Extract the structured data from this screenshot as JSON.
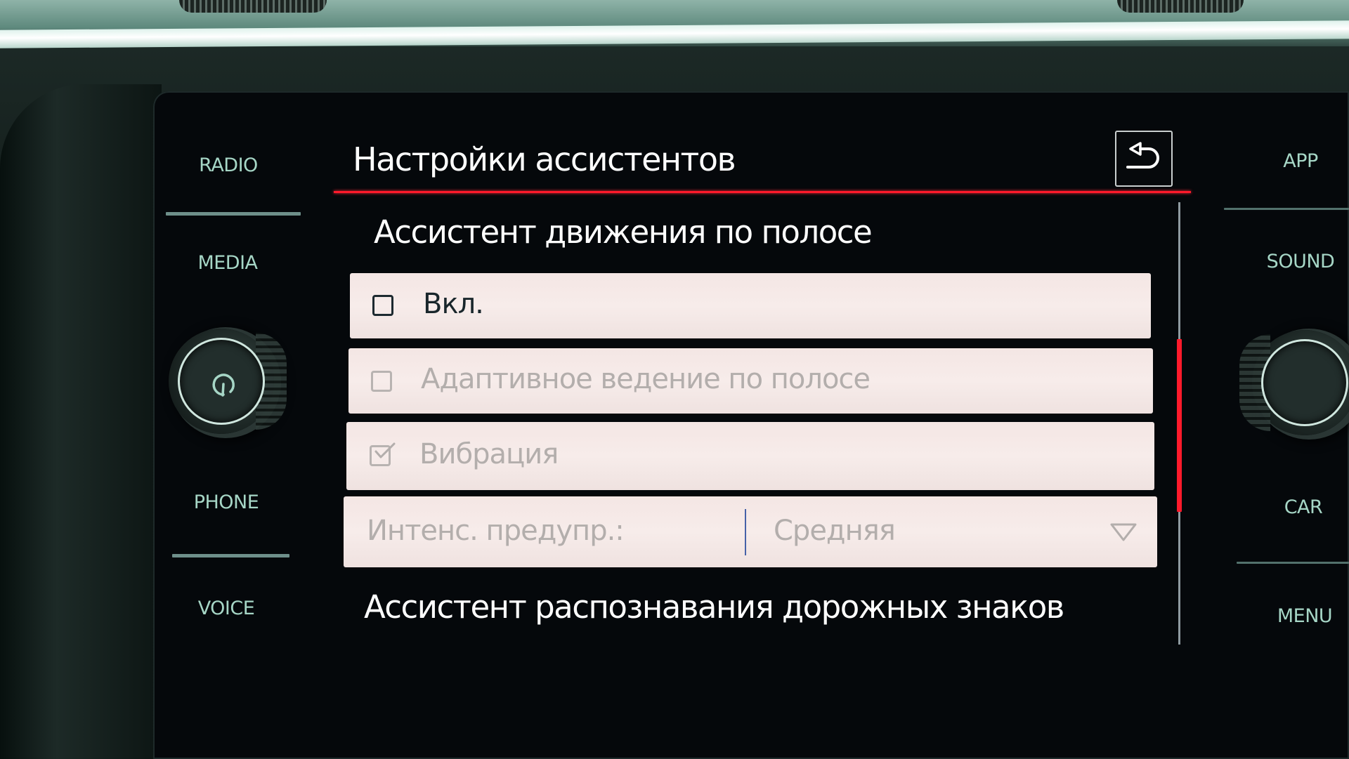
{
  "screen": {
    "title": "Настройки ассистентов",
    "back_icon": "back-arrow-icon"
  },
  "nav_left": {
    "items": [
      {
        "id": "radio",
        "label": "RADIO"
      },
      {
        "id": "media",
        "label": "MEDIA"
      },
      {
        "id": "phone",
        "label": "PHONE"
      },
      {
        "id": "voice",
        "label": "VOICE"
      }
    ],
    "knob_icon": "power-icon"
  },
  "nav_right": {
    "items": [
      {
        "id": "app",
        "label": "APP"
      },
      {
        "id": "sound",
        "label": "SOUND"
      },
      {
        "id": "car",
        "label": "CAR"
      },
      {
        "id": "menu",
        "label": "MENU"
      }
    ]
  },
  "sections": [
    {
      "header": "Ассистент движения по полосе",
      "rows": [
        {
          "type": "checkbox",
          "label": "Вкл.",
          "checked": false,
          "enabled": true
        },
        {
          "type": "checkbox",
          "label": "Адаптивное ведение по полосе",
          "checked": false,
          "enabled": false
        },
        {
          "type": "checkbox",
          "label": "Вибрация",
          "checked": true,
          "enabled": false
        },
        {
          "type": "select",
          "label": "Интенс. предупр.:",
          "value": "Средняя",
          "enabled": false,
          "icon": "dropdown-triangle-icon"
        }
      ]
    },
    {
      "header": "Ассистент распознавания дорожных знаков"
    }
  ],
  "scrollbar": {
    "thumb_start": 0.31,
    "thumb_end": 0.7
  },
  "colors": {
    "accent_red": "#ff1a2b",
    "nav_text": "#a6d6c6",
    "row_bg": "#f5e8e6",
    "text_enabled": "#19262b",
    "text_disabled": "#b3aeac"
  }
}
